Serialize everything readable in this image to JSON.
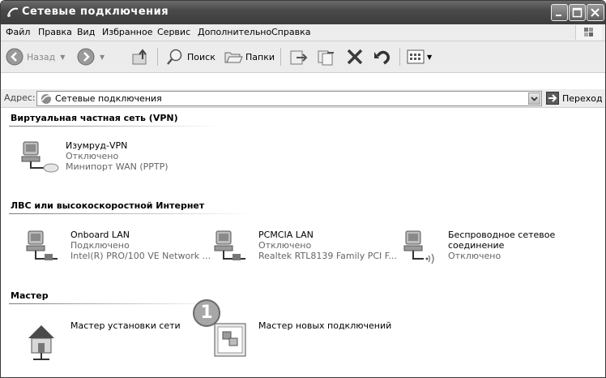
{
  "window": {
    "title": "Сетевые подключения"
  },
  "menu": {
    "items": [
      "Файл",
      "Правка",
      "Вид",
      "Избранное",
      "Сервис",
      "Дополнительно",
      "Справка"
    ]
  },
  "toolbar": {
    "back_label": "Назад",
    "search_label": "Поиск",
    "folders_label": "Папки"
  },
  "address": {
    "label": "Адрес:",
    "value": "Сетевые подключения",
    "go_label": "Переход"
  },
  "groups": [
    {
      "title": "Виртуальная частная сеть (VPN)",
      "items": [
        {
          "name": "Изумруд-VPN",
          "status": "Отключено",
          "device": "Минипорт WAN (PPTP)"
        }
      ]
    },
    {
      "title": "ЛВС или высокоскоростной Интернет",
      "items": [
        {
          "name": "Onboard LAN",
          "status": "Подключено",
          "device": "Intel(R) PRO/100 VE Network ..."
        },
        {
          "name": "PCMCIA LAN",
          "status": "Отключено",
          "device": "Realtek RTL8139 Family PCI F..."
        },
        {
          "name": "Беспроводное сетевое",
          "name2": "соединение",
          "status": "Отключено"
        }
      ]
    },
    {
      "title": "Мастер",
      "items": [
        {
          "name": "Мастер установки сети"
        },
        {
          "name": "Мастер новых подключений"
        }
      ]
    }
  ],
  "callout": "1",
  "icons": [
    "network-connections-icon",
    "minimize-icon",
    "maximize-icon",
    "close-icon",
    "windows-logo-icon",
    "back-icon",
    "forward-icon",
    "up-folder-icon",
    "search-icon",
    "folders-icon",
    "move-to-icon",
    "copy-to-icon",
    "delete-icon",
    "undo-icon",
    "views-icon",
    "go-arrow-icon",
    "vpn-connection-icon",
    "lan-connection-icon",
    "wireless-connection-icon",
    "network-setup-wizard-icon",
    "new-connection-wizard-icon"
  ]
}
